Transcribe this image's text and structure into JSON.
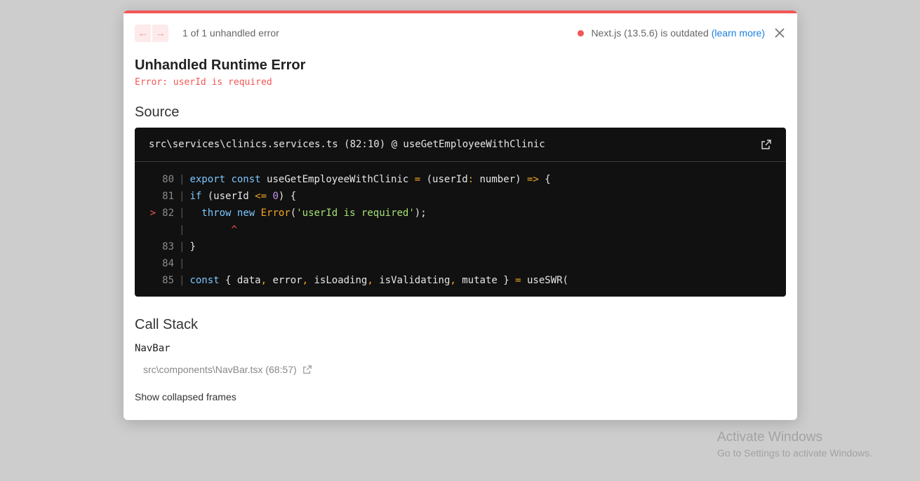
{
  "header": {
    "prev_glyph": "←",
    "next_glyph": "→",
    "counter": "1 of 1 unhandled error",
    "version_text": "Next.js (13.5.6) is outdated",
    "learn_more": "(learn more)"
  },
  "error": {
    "title": "Unhandled Runtime Error",
    "message": "Error: userId is required"
  },
  "source": {
    "heading": "Source",
    "file": "src\\services\\clinics.services.ts (82:10) @ useGetEmployeeWithClinic",
    "lines": [
      {
        "num": "80",
        "marker": ""
      },
      {
        "num": "81",
        "marker": ""
      },
      {
        "num": "82",
        "marker": ">"
      },
      {
        "num": "",
        "marker": "",
        "caret": "^"
      },
      {
        "num": "83",
        "marker": ""
      },
      {
        "num": "84",
        "marker": ""
      },
      {
        "num": "85",
        "marker": ""
      }
    ]
  },
  "call_stack": {
    "heading": "Call Stack",
    "frame_name": "NavBar",
    "frame_location": "src\\components\\NavBar.tsx (68:57)",
    "show_collapsed": "Show collapsed frames"
  },
  "watermark": {
    "line1": "Activate Windows",
    "line2": "Go to Settings to activate Windows."
  },
  "colors": {
    "accent": "#f35656",
    "link": "#1a7fe0",
    "code_bg": "#111111"
  }
}
